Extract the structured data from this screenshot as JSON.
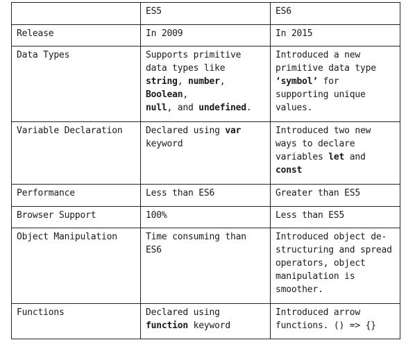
{
  "table": {
    "header": {
      "feature": "",
      "es5": "ES5",
      "es6": "ES6"
    },
    "rows": {
      "release": {
        "feature": "Release",
        "es5": "In 2009",
        "es6": "In 2015"
      },
      "data_types": {
        "feature": "Data Types",
        "es5": {
          "t1": "Supports primitive data types like ",
          "b1": "string",
          "t2": ", ",
          "b2": "number",
          "t3": ", ",
          "b3": "Boolean",
          "t4": ", ",
          "b4": "null",
          "t5": ", and ",
          "b5": "undefined",
          "t6": "."
        },
        "es6": {
          "t1": "Introduced a new primitive data type ",
          "b1": "‘symbol’",
          "t2": " for supporting unique values."
        }
      },
      "variable_declaration": {
        "feature": "Variable Declaration",
        "es5": {
          "t1": "Declared using ",
          "b1": "var",
          "t2": " keyword"
        },
        "es6": {
          "t1": "Introduced two new ways to declare variables ",
          "b1": "let",
          "t2": " and ",
          "b2": "const"
        }
      },
      "performance": {
        "feature": "Performance",
        "es5": "Less than ES6",
        "es6": "Greater than ES5"
      },
      "browser_support": {
        "feature": "Browser Support",
        "es5": "100%",
        "es6": "Less than ES5"
      },
      "object_manipulation": {
        "feature": "Object Manipulation",
        "es5": "Time consuming than ES6",
        "es6": "Introduced object de-structuring and spread operators, object manipulation is smoother."
      },
      "functions": {
        "feature": "Functions",
        "es5": {
          "t1": "Declared using ",
          "b1": "function",
          "t2": " keyword"
        },
        "es6": "Introduced arrow functions. () => {}"
      }
    }
  }
}
